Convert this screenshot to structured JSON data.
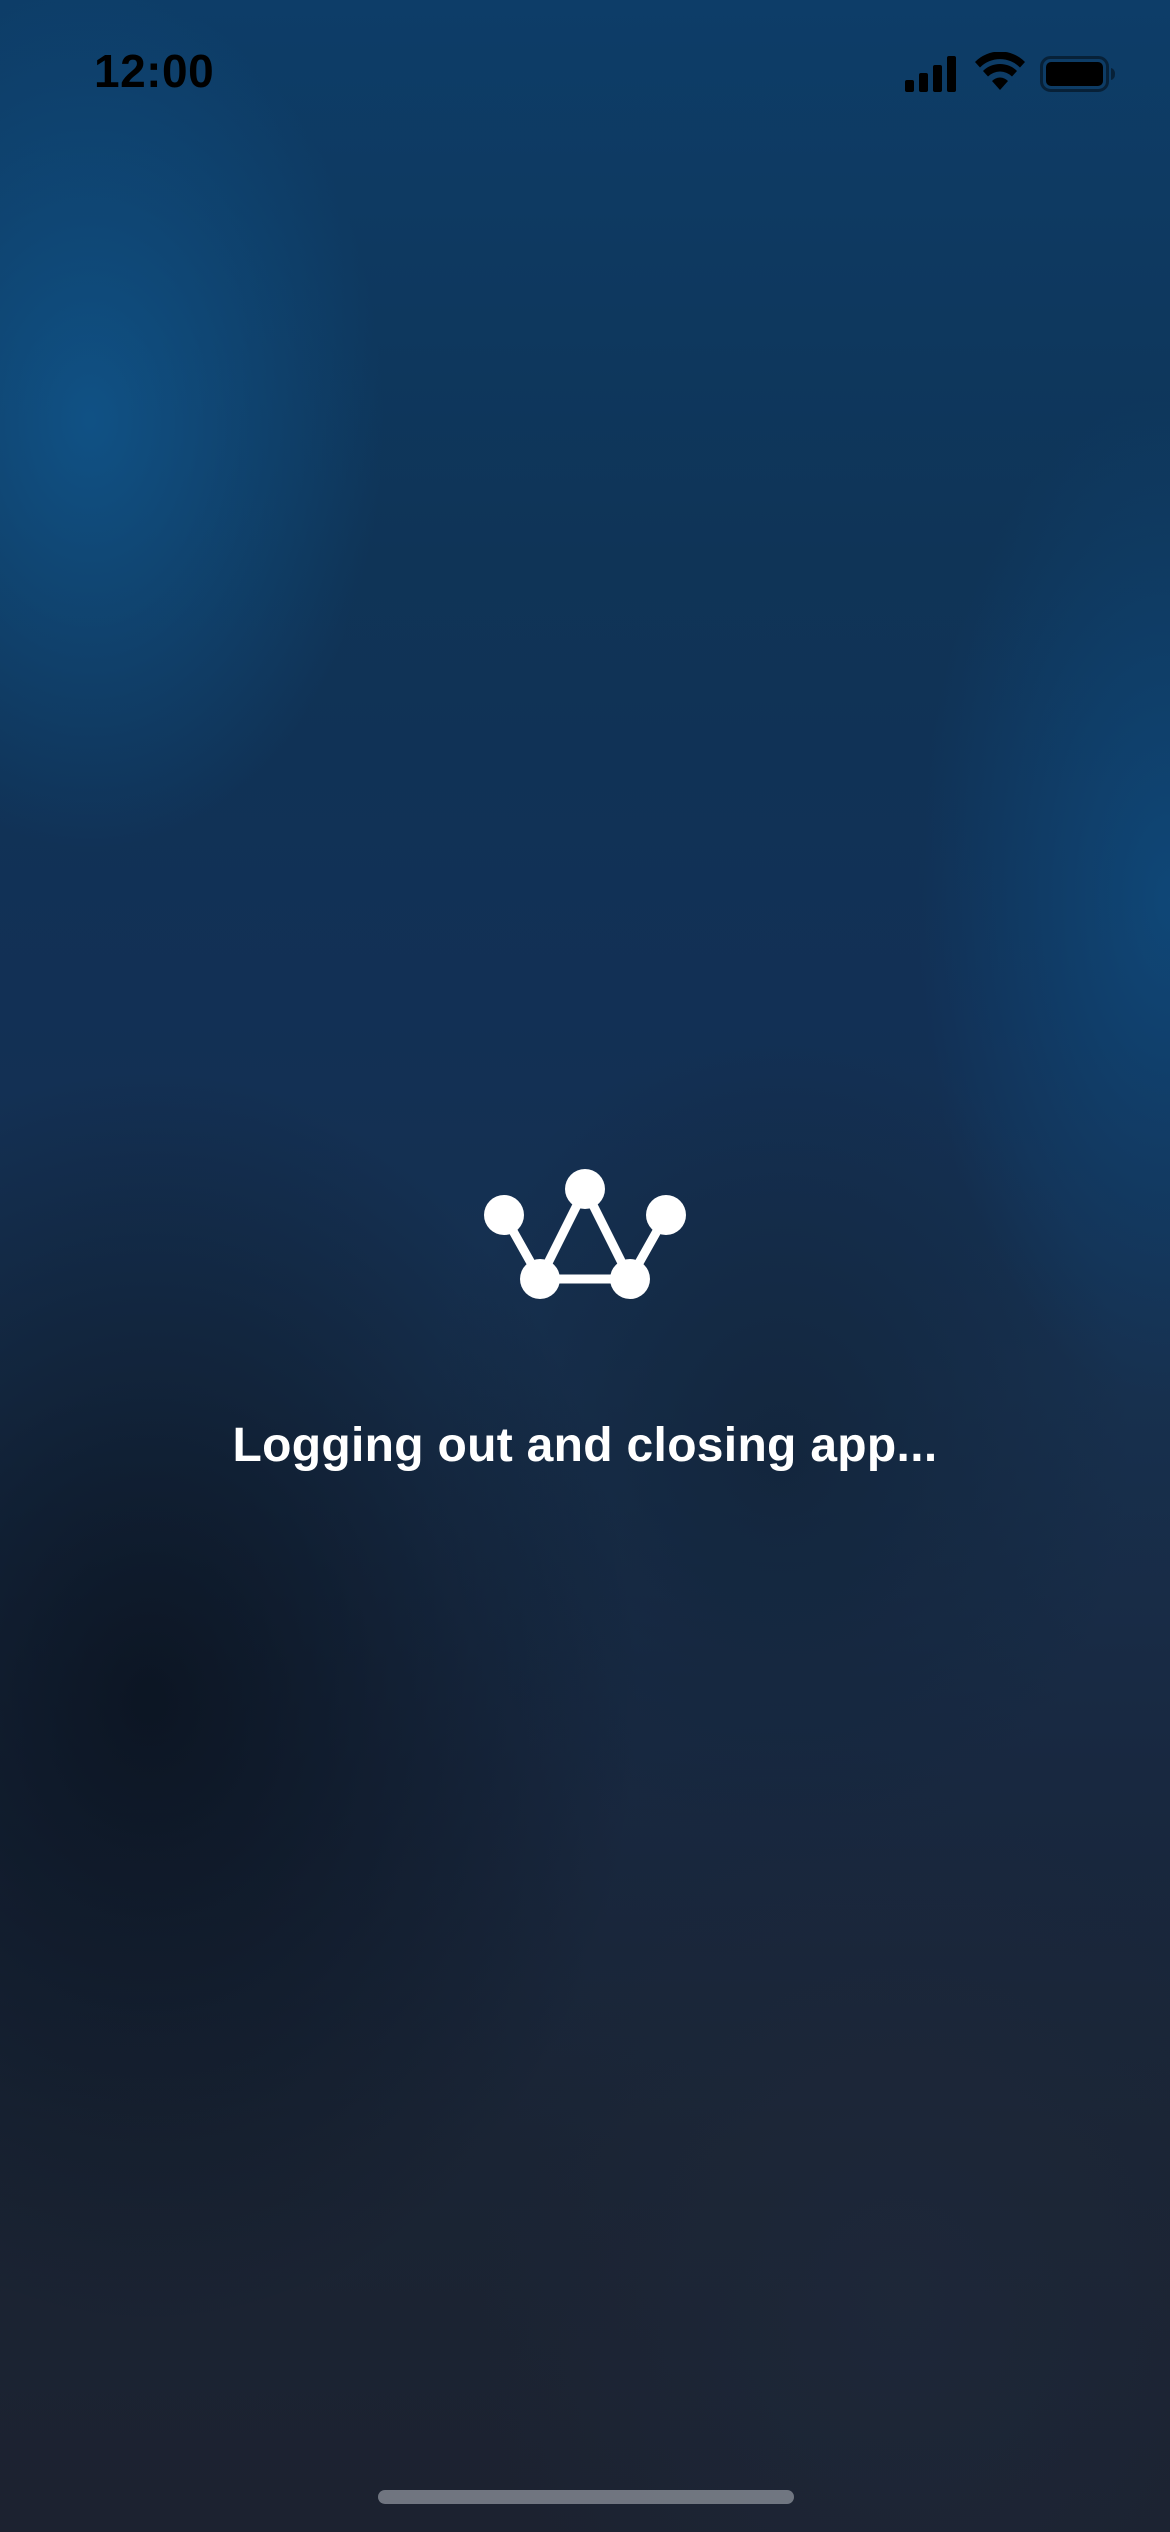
{
  "status_bar": {
    "time": "12:00",
    "icons": [
      "cellular-signal-icon",
      "wifi-icon",
      "battery-icon"
    ]
  },
  "main": {
    "logo": "app-logo-icon",
    "message": "Logging out and closing app..."
  },
  "colors": {
    "background_top": "#0d3d68",
    "background_bottom": "#1c2230",
    "text": "#ffffff",
    "status_bar_text": "#000000"
  }
}
